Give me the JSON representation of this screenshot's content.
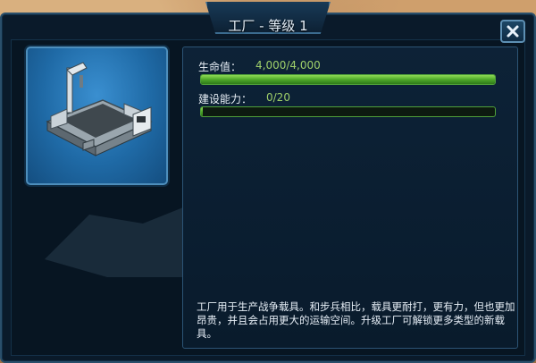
{
  "dialog": {
    "title": "工厂 - 等级 1",
    "close_icon": "close-icon"
  },
  "building": {
    "image_icon": "factory-building-icon"
  },
  "stats": {
    "health": {
      "label": "生命值：",
      "value": "4,000/4,000",
      "fraction": 1.0
    },
    "build_capacity": {
      "label": "建设能力：",
      "value": "0/20",
      "fraction": 0.0
    }
  },
  "description": "工厂用于生产战争载具。和步兵相比，载具更耐打，更有力，但也更加昂贵，并且会占用更大的运输空间。升级工厂可解锁更多类型的新载具。",
  "colors": {
    "accent": "#4d8ebc",
    "bar_fill": "#4ea82a",
    "value_text": "#9fd06a"
  }
}
